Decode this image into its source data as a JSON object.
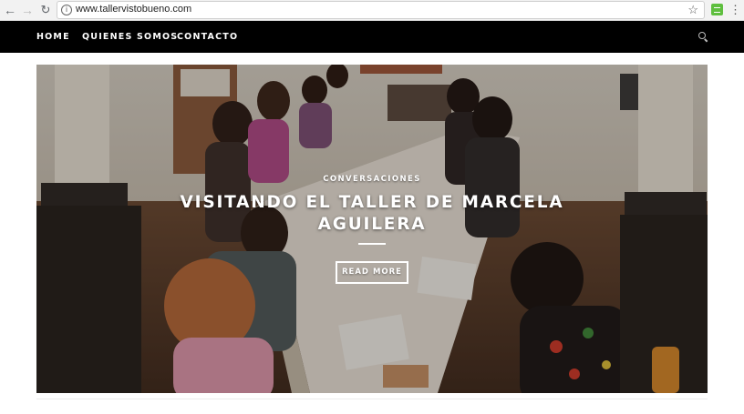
{
  "browser": {
    "url": "www.tallervistobueno.com",
    "back_icon": "arrow-left-icon",
    "forward_icon": "arrow-right-icon",
    "reload_icon": "reload-icon",
    "info_icon": "info-icon",
    "bookmark_icon": "star-icon",
    "extension_icon": "extension-icon",
    "menu_icon": "kebab-menu-icon"
  },
  "site_nav": {
    "items": [
      {
        "label": "HOME"
      },
      {
        "label": "QUIENES SOMOS"
      },
      {
        "label": "CONTACTO"
      }
    ],
    "search_icon": "search-icon",
    "background": "#000000"
  },
  "hero": {
    "category": "CONVERSACIONES",
    "title": "VISITANDO EL TALLER DE MARCELA AGUILERA",
    "cta_label": "READ MORE"
  }
}
